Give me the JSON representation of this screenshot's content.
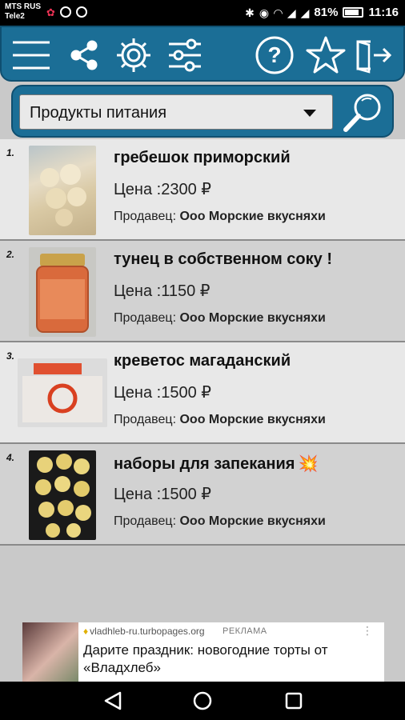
{
  "status_bar": {
    "carrier_line1": "MTS RUS",
    "carrier_line2": "Tele2",
    "battery": "81%",
    "time": "11:16"
  },
  "toolbar": {
    "icons": [
      "menu-icon",
      "share-icon",
      "gear-icon",
      "filter-sliders-icon",
      "help-icon",
      "star-icon",
      "exit-icon"
    ],
    "help_glyph": "?"
  },
  "search": {
    "category_value": "Продукты питания",
    "icon": "magnifier-icon"
  },
  "items": [
    {
      "num": "1.",
      "title": "гребешок приморский",
      "price": "Цена :2300 ₽",
      "seller_label": "Продавец:",
      "seller": "Ооо Морские вкусняхи",
      "emoji": ""
    },
    {
      "num": "2.",
      "title": "тунец в собственном соку !",
      "price": "Цена :1150 ₽",
      "seller_label": "Продавец:",
      "seller": "Ооо Морские вкусняхи",
      "emoji": ""
    },
    {
      "num": "3.",
      "title": "креветос магаданский",
      "price": "Цена :1500 ₽",
      "seller_label": "Продавец:",
      "seller": "Ооо Морские вкусняхи",
      "emoji": ""
    },
    {
      "num": "4.",
      "title": "наборы для запекания",
      "price": "Цена :1500 ₽",
      "seller_label": "Продавец:",
      "seller": "Ооо Морские вкусняхи",
      "emoji": "💥"
    }
  ],
  "ad": {
    "domain": "vladhleb-ru.turbopages.org",
    "badge": "РЕКЛАМА",
    "text": "Дарите праздник: новогодние торты от «Владхлеб»",
    "menu_glyph": "⋮",
    "leaf_glyph": "♦"
  },
  "colors": {
    "toolbar": "#1b6e96",
    "row_light": "#e8e8e8",
    "row_dark": "#d2d2d2"
  }
}
